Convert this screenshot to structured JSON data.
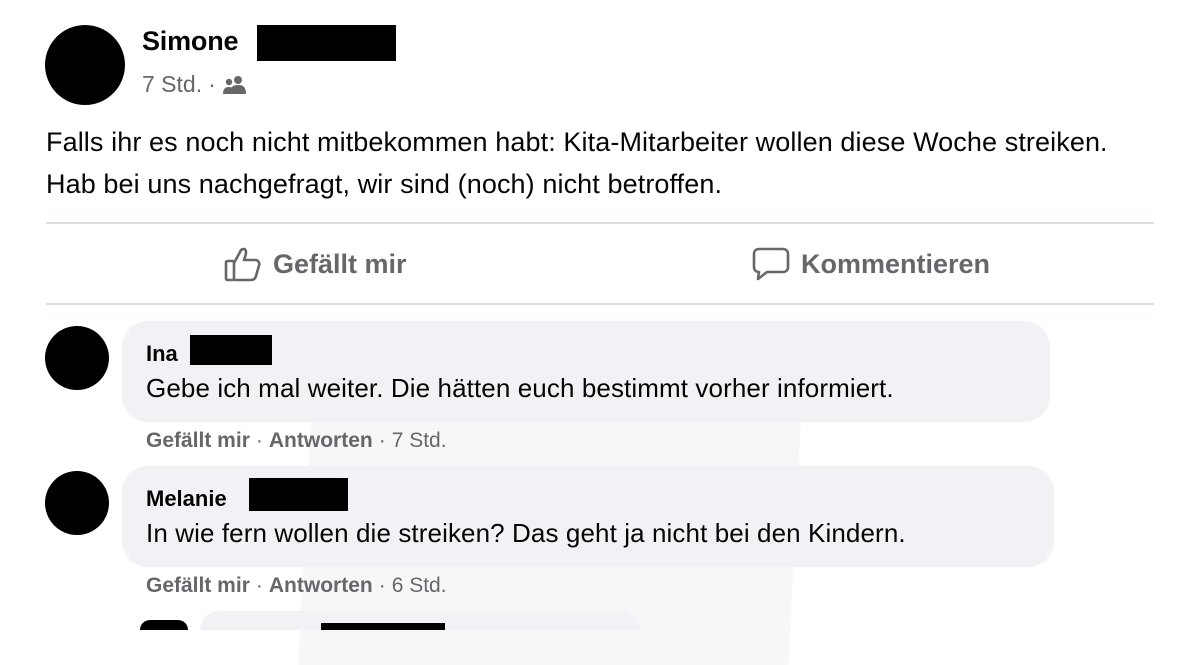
{
  "post": {
    "author": "Simone",
    "time": "7 Std.",
    "separator": "·",
    "audience_icon": "friends-icon",
    "text": "Falls ihr es noch nicht mitbekommen habt: Kita-Mitarbeiter wollen diese Woche streiken. Hab bei uns nachgefragt, wir sind (noch) nicht betroffen."
  },
  "actions": {
    "like_label": "Gefällt mir",
    "like_icon": "thumbs-up-icon",
    "comment_label": "Kommentieren",
    "comment_icon": "speech-bubble-icon"
  },
  "comments": [
    {
      "author": "Ina",
      "text": "Gebe ich mal weiter. Die hätten euch bestimmt vorher informiert.",
      "like_label": "Gefällt mir",
      "reply_label": "Antworten",
      "separator": "·",
      "time": "7 Std."
    },
    {
      "author": "Melanie",
      "text": "In wie fern wollen die streiken? Das geht ja nicht bei den Kindern.",
      "like_label": "Gefällt mir",
      "reply_label": "Antworten",
      "separator": "·",
      "time": "6 Std."
    }
  ],
  "colors": {
    "text_primary": "#050505",
    "text_secondary": "#65676b",
    "bubble_bg": "#f0f2f5",
    "divider": "#dadde1",
    "redaction": "#000000"
  }
}
